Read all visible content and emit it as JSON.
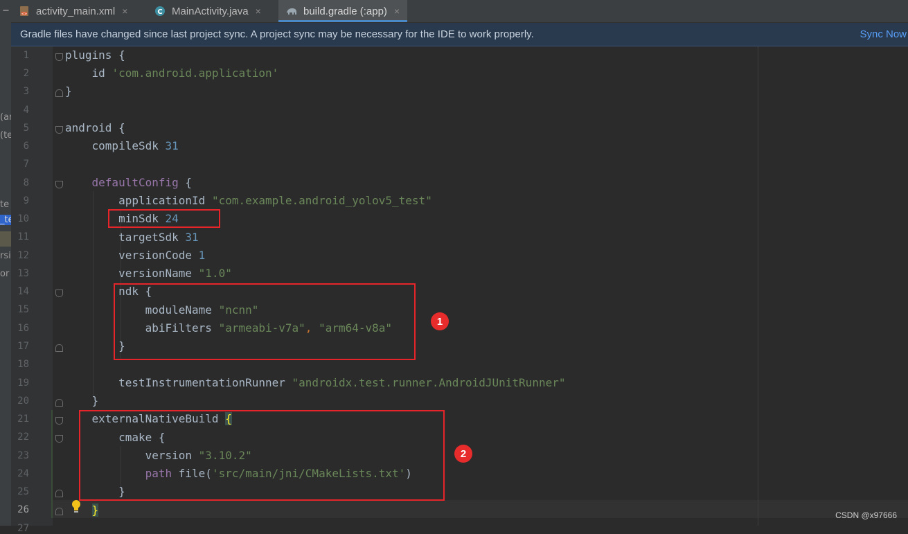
{
  "tabs": [
    {
      "label": "activity_main.xml",
      "icon": "xml-layout-icon",
      "active": false
    },
    {
      "label": "MainActivity.java",
      "icon": "java-class-icon",
      "active": false
    },
    {
      "label": "build.gradle (:app)",
      "icon": "gradle-elephant-icon",
      "active": true
    }
  ],
  "tab_close_glyph": "×",
  "banner": {
    "message": "Gradle files have changed since last project sync. A project sync may be necessary for the IDE to work properly.",
    "action": "Sync Now"
  },
  "left_panel_fragments": [
    "(ar",
    "(te",
    "te",
    "_te",
    "rsi",
    "or a"
  ],
  "line_numbers": [
    "1",
    "2",
    "3",
    "4",
    "5",
    "6",
    "7",
    "8",
    "9",
    "10",
    "11",
    "12",
    "13",
    "14",
    "15",
    "16",
    "17",
    "18",
    "19",
    "20",
    "21",
    "22",
    "23",
    "24",
    "25",
    "26",
    "27"
  ],
  "code": {
    "l1": {
      "kw": "plugins",
      "br": " {"
    },
    "l2": {
      "kw": "id",
      "str": "'com.android.application'"
    },
    "l3": {
      "br": "}"
    },
    "l5": {
      "kw": "android",
      "br": " {"
    },
    "l6": {
      "kw": "compileSdk",
      "num": "31"
    },
    "l8": {
      "kw": "defaultConfig",
      "br": " {"
    },
    "l9": {
      "kw": "applicationId",
      "str": "\"com.example.android_yolov5_test\""
    },
    "l10": {
      "kw": "minSdk",
      "num": "24"
    },
    "l11": {
      "kw": "targetSdk",
      "num": "31"
    },
    "l12": {
      "kw": "versionCode",
      "num": "1"
    },
    "l13": {
      "kw": "versionName",
      "str": "\"1.0\""
    },
    "l14": {
      "kw": "ndk",
      "br": " {"
    },
    "l15": {
      "kw": "moduleName",
      "str": "\"ncnn\""
    },
    "l16": {
      "kw": "abiFilters",
      "str1": "\"armeabi-v7a\"",
      "comma": ", ",
      "str2": "\"arm64-v8a\""
    },
    "l17": {
      "br": "}"
    },
    "l19": {
      "kw": "testInstrumentationRunner",
      "str": "\"androidx.test.runner.AndroidJUnitRunner\""
    },
    "l20": {
      "br": "}"
    },
    "l21": {
      "kw": "externalNativeBuild",
      "br": "{"
    },
    "l22": {
      "kw": "cmake",
      "br": " {"
    },
    "l23": {
      "kw": "version",
      "str": "\"3.10.2\""
    },
    "l24": {
      "kw": "path",
      "fn": "file(",
      "str": "'src/main/jni/CMakeLists.txt'",
      "close": ")"
    },
    "l25": {
      "br": "}"
    },
    "l26": {
      "br": "}"
    }
  },
  "annotations": {
    "badge1": "1",
    "badge2": "2"
  },
  "watermark": "CSDN @x97666",
  "colors": {
    "background": "#2b2b2b",
    "keyword": "#cc7832",
    "method": "#9876aa",
    "string": "#6a8759",
    "number": "#6897bb",
    "annotation_box": "#e6252a",
    "banner_bg": "#293a4e",
    "link": "#589df6"
  }
}
